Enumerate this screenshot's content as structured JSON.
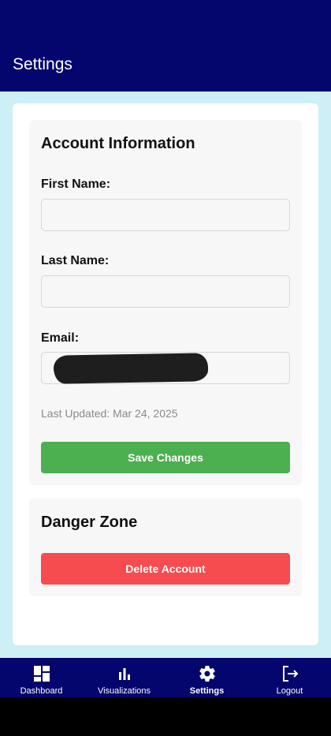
{
  "header": {
    "title": "Settings"
  },
  "account": {
    "title": "Account Information",
    "first_name": {
      "label": "First Name:",
      "value": ""
    },
    "last_name": {
      "label": "Last Name:",
      "value": ""
    },
    "email": {
      "label": "Email:",
      "value": ""
    },
    "last_updated": "Last Updated: Mar 24, 2025",
    "save_label": "Save Changes"
  },
  "danger": {
    "title": "Danger Zone",
    "delete_label": "Delete Account"
  },
  "colors": {
    "header": "#05056e",
    "background": "#cdeff6",
    "save": "#4caf50",
    "delete": "#f64b4f"
  },
  "nav": {
    "items": [
      {
        "label": "Dashboard",
        "icon": "dashboard-icon"
      },
      {
        "label": "Visualizations",
        "icon": "bar-chart-icon"
      },
      {
        "label": "Settings",
        "icon": "gear-icon",
        "active": true
      },
      {
        "label": "Logout",
        "icon": "logout-icon"
      }
    ]
  }
}
